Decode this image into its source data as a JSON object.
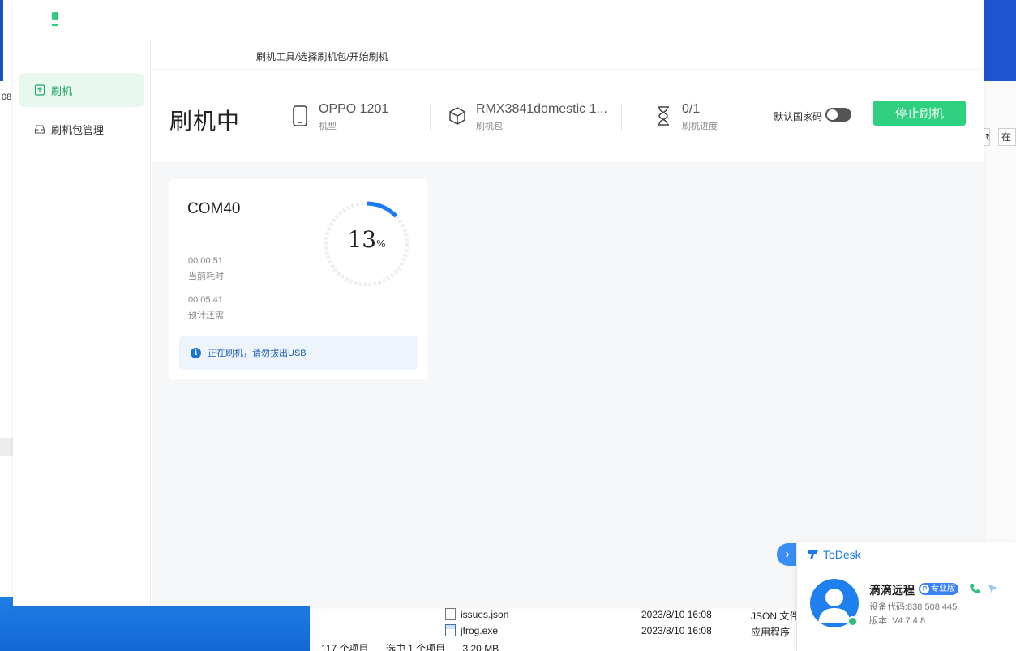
{
  "sidebar": {
    "items": [
      {
        "label": "刷机",
        "icon": "upload-file-icon",
        "active": true
      },
      {
        "label": "刷机包管理",
        "icon": "inbox-icon",
        "active": false
      }
    ]
  },
  "breadcrumb": "刷机工具/选择刷机包/开始刷机",
  "header": {
    "status_title": "刷机中",
    "model": {
      "value": "OPPO 1201",
      "label": "机型",
      "icon": "phone-icon"
    },
    "package": {
      "value": "RMX3841domestic 1...",
      "label": "刷机包",
      "icon": "box-icon"
    },
    "progress": {
      "value": "0/1",
      "label": "刷机进度",
      "icon": "hourglass-icon"
    },
    "toggle_label": "默认国家码",
    "toggle_on": false,
    "stop_button": "停止刷机"
  },
  "device_card": {
    "port": "COM40",
    "elapsed_value": "00:00:51",
    "elapsed_label": "当前耗时",
    "remaining_value": "00:05:41",
    "remaining_label": "预计还需",
    "percent": 13,
    "percent_text": "13",
    "percent_unit": "%",
    "notice": "正在刷机，请勿拔出USB"
  },
  "explorer": {
    "files": [
      {
        "name": "issues.json",
        "date": "2023/8/10 16:08",
        "type": "JSON 文件"
      },
      {
        "name": "jfrog.exe",
        "date": "2023/8/10 16:08",
        "type": "应用程序"
      }
    ],
    "status": {
      "count": "117 个项目",
      "selected": "选中 1 个项目",
      "size": "3.20 MB"
    }
  },
  "background": {
    "left_text_top": "08",
    "right_button_1": "↻",
    "right_button_2": "在"
  },
  "todesk": {
    "brand": "ToDesk",
    "user_name": "滴滴远程",
    "badge": "专业版",
    "badge_letter": "P",
    "device_code": "设备代码:838 508 445",
    "version": "版本: V4.7.4.8"
  },
  "colors": {
    "accent_green": "#2fcf80",
    "active_nav_bg": "#e8f8ef",
    "progress_blue": "#1a7cf0",
    "todesk_blue": "#1f7fee"
  }
}
